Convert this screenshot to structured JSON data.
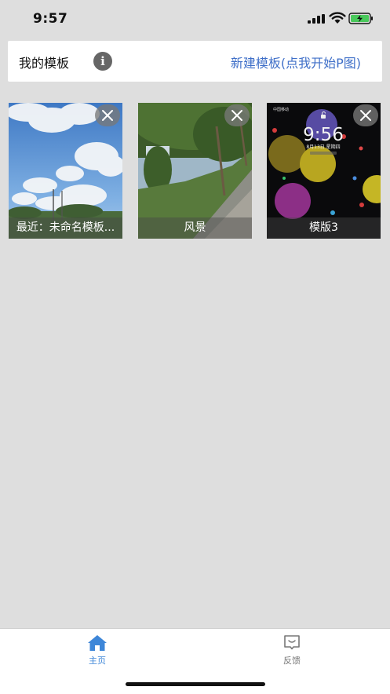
{
  "status_bar": {
    "time": "9:57"
  },
  "header": {
    "title": "我的模板",
    "new_template_link": "新建模板(点我开始P图)"
  },
  "templates": [
    {
      "label": "最近：未命名模板...",
      "image": "sky-clouds-photo"
    },
    {
      "label": "风景",
      "image": "trees-path-photo"
    },
    {
      "label": "模版3",
      "image": "lockscreen-bokeh",
      "lockscreen": {
        "carrier": "中国移动",
        "clock": "9:56",
        "date": "8月13日 星期四"
      }
    }
  ],
  "tab_bar": {
    "items": [
      {
        "label": "主页",
        "icon": "home-icon",
        "active": true
      },
      {
        "label": "反馈",
        "icon": "feedback-icon",
        "active": false
      }
    ],
    "active_color": "#3d86d8"
  }
}
